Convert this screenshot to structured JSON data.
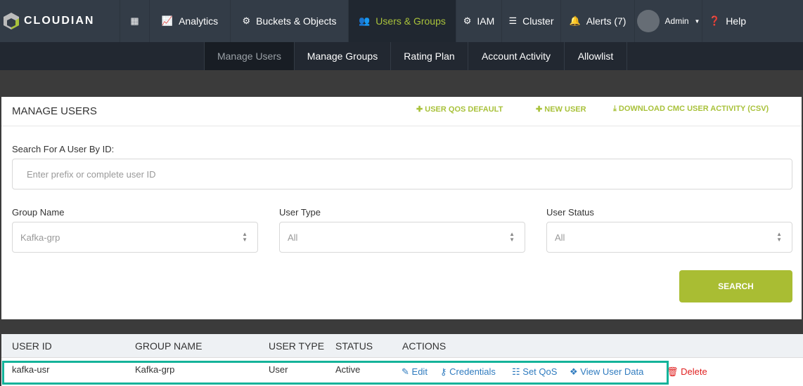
{
  "brand": {
    "name": "CLOUDIAN",
    "accent": "#a9c23b"
  },
  "nav": [
    {
      "label": "",
      "icon": "grid-icon"
    },
    {
      "label": "Analytics",
      "icon": "chart-icon"
    },
    {
      "label": "Buckets & Objects",
      "icon": "gear-icon"
    },
    {
      "label": "Users & Groups",
      "icon": "users-icon",
      "active": true
    },
    {
      "label": "IAM",
      "icon": "gear-icon"
    },
    {
      "label": "Cluster",
      "icon": "server-icon"
    },
    {
      "label": "Alerts (7)",
      "icon": "bell-icon"
    },
    {
      "label": "Admin",
      "icon": "avatar-icon"
    },
    {
      "label": "Help",
      "icon": "help-icon"
    }
  ],
  "subnav": [
    "Manage Users",
    "Manage Groups",
    "Rating Plan",
    "Account Activity",
    "Allowlist"
  ],
  "panel": {
    "title": "MANAGE USERS",
    "links": [
      "USER QOS DEFAULT",
      "NEW USER",
      "DOWNLOAD CMC USER ACTIVITY (CSV)"
    ],
    "search_label": "Search For A User By ID:",
    "search_placeholder": "Enter prefix or complete user ID",
    "group_label": "Group Name",
    "group_value": "Kafka-grp",
    "type_label": "User Type",
    "type_value": "All",
    "status_label": "User Status",
    "status_value": "All",
    "search_button": "SEARCH"
  },
  "table": {
    "headers": [
      "USER ID",
      "GROUP NAME",
      "USER TYPE",
      "STATUS",
      "ACTIONS"
    ],
    "rows": [
      {
        "id": "kafka-usr",
        "group": "Kafka-grp",
        "type": "User",
        "status": "Active"
      }
    ],
    "actions": [
      "Edit",
      "Credentials",
      "Set QoS",
      "View User Data",
      "Delete"
    ]
  }
}
